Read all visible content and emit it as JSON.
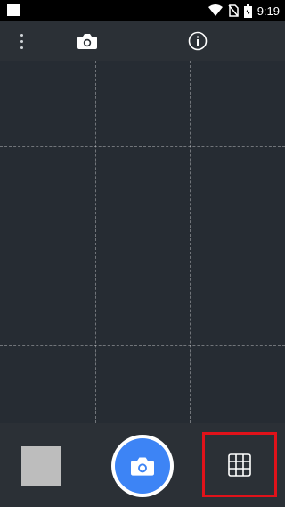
{
  "status_bar": {
    "time": "9:19",
    "icons": [
      "wifi-icon",
      "no-sim-icon",
      "battery-charging-icon"
    ]
  },
  "toolbar": {
    "menu_icon": "more-vert-icon",
    "tabs": [
      {
        "name": "camera",
        "icon": "camera-icon",
        "selected": true
      },
      {
        "name": "info",
        "icon": "info-icon",
        "selected": false
      }
    ]
  },
  "viewfinder": {
    "grid_overlay": true,
    "grid_divisions": 3
  },
  "controls": {
    "gallery_thumbnail_color": "#bdbdbd",
    "shutter_icon": "camera-icon",
    "shutter_color": "#3d84f5",
    "grid_toggle_icon": "grid-icon",
    "highlight_color": "#e0121a"
  }
}
